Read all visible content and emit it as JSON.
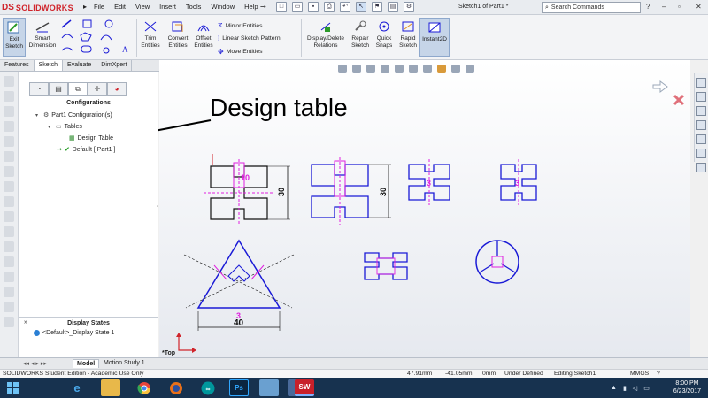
{
  "app": {
    "logo_ds": "DS",
    "logo_text": "SOLIDWORKS",
    "document_title": "Sketch1 of Part1 *",
    "menu": [
      "File",
      "Edit",
      "View",
      "Insert",
      "Tools",
      "Window",
      "Help"
    ],
    "search_placeholder": "Search Commands"
  },
  "commands": {
    "exit_sketch": "Exit\nSketch",
    "smart_dimension": "Smart\nDimension",
    "trim_entities": "Trim\nEntities",
    "convert_entities": "Convert\nEntities",
    "offset_entities": "Offset\nEntities",
    "mirror_entities": "Mirror Entities",
    "linear_pattern": "Linear Sketch Pattern",
    "move_entities": "Move Entities",
    "display_delete_relations": "Display/Delete\nRelations",
    "repair_sketch": "Repair\nSketch",
    "quick_snaps": "Quick\nSnaps",
    "rapid_sketch": "Rapid\nSketch",
    "instant2d": "Instant2D"
  },
  "tabs": [
    "Features",
    "Sketch",
    "Evaluate",
    "DimXpert"
  ],
  "active_tab": "Sketch",
  "feature_manager": {
    "heading": "Configurations",
    "config_root": "Part1 Configuration(s)",
    "tables": "Tables",
    "design_table": "Design Table",
    "default_config": "Default [ Part1 ]",
    "display_states_heading": "Display States",
    "display_state_item": "<Default>_Display State 1"
  },
  "annotation": "Design table",
  "viewport": {
    "view_label": "*Top",
    "dimension_30": "30",
    "dimension_40": "40",
    "dimension_3": "3",
    "dimension_10": "10"
  },
  "bottom_tabs": [
    "Model",
    "Motion Study 1"
  ],
  "status": {
    "edition": "SOLIDWORKS Student Edition - Academic Use Only",
    "x": "47.91mm",
    "y": "-41.05mm",
    "z": "0mm",
    "state": "Under Defined",
    "editing": "Editing Sketch1",
    "units": "MMGS"
  },
  "taskbar": {
    "time": "8:00 PM",
    "date": "6/23/2017",
    "app_sw_label": "SW",
    "app_ps_label": "Ps"
  },
  "colors": {
    "sketch_blue": "#1a1ad6",
    "dim_magenta": "#e020e0",
    "dim_black": "#111111",
    "brand_red": "#d0242b",
    "taskbar": "#17324f"
  }
}
